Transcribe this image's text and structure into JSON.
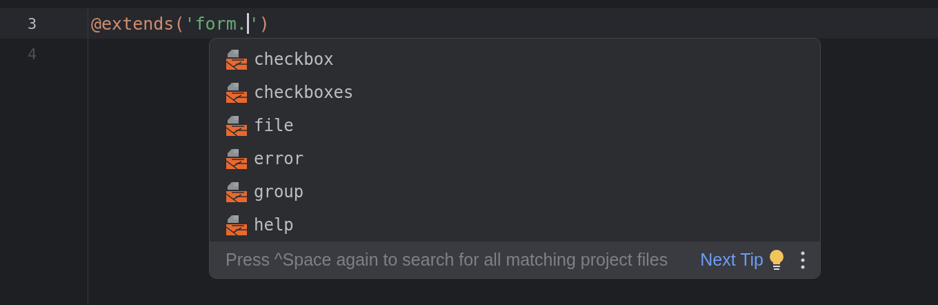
{
  "editor": {
    "lines": [
      {
        "number": "3",
        "current": true,
        "tokens": [
          {
            "kind": "keyword",
            "text": "@extends("
          },
          {
            "kind": "string",
            "text": "'form."
          },
          {
            "kind": "caret"
          },
          {
            "kind": "string",
            "text": "'"
          },
          {
            "kind": "keyword",
            "text": ")"
          }
        ]
      },
      {
        "number": "4",
        "current": false
      }
    ]
  },
  "completion": {
    "items": [
      {
        "label": "checkbox"
      },
      {
        "label": "checkboxes"
      },
      {
        "label": "file"
      },
      {
        "label": "error"
      },
      {
        "label": "group"
      },
      {
        "label": "help"
      }
    ],
    "footer": {
      "hint": "Press ^Space again to search for all matching project files",
      "link": "Next Tip"
    }
  }
}
